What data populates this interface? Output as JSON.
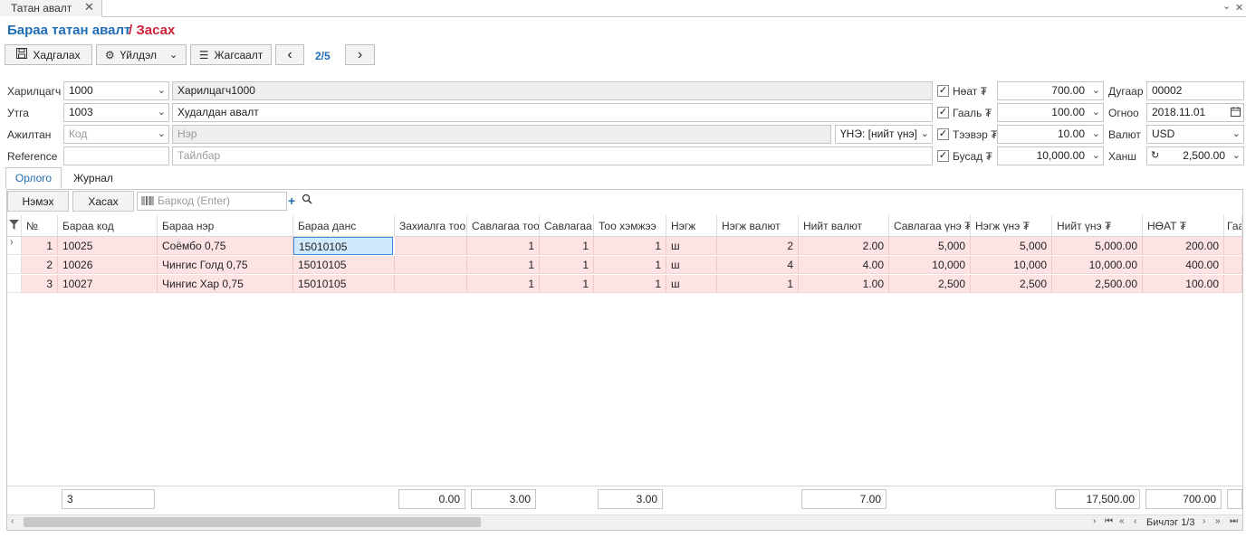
{
  "tab": {
    "label": "Татан авалт",
    "close": "✕"
  },
  "window": {
    "chevron": "⌄",
    "close": "✕"
  },
  "header": {
    "title": "Бараа татан авалт",
    "subtitle": "/ Засах"
  },
  "toolbar": {
    "save_label": "Хадгалах",
    "action_label": "Үйлдэл",
    "list_label": "Жагсаалт",
    "page": "2/5"
  },
  "form": {
    "partner": {
      "label": "Харилцагч",
      "code": "1000",
      "name": "Харилцагч1000"
    },
    "route": {
      "label": "Утга",
      "code": "1003",
      "name": "Худалдан авалт"
    },
    "employee": {
      "label": "Ажилтан",
      "code_placeholder": "Код",
      "name_placeholder": "Нэр",
      "price_mode": "ҮНЭ: [нийт үнэ]"
    },
    "reference": {
      "label": "Reference",
      "value": "",
      "desc_placeholder": "Тайлбар"
    },
    "vat": {
      "label": "Нөат ₮",
      "checked": true,
      "value": "700.00"
    },
    "customs": {
      "label": "Гааль ₮",
      "checked": true,
      "value": "100.00"
    },
    "transport": {
      "label": "Тээвэр ₮",
      "checked": true,
      "value": "10.00"
    },
    "other": {
      "label": "Бусад ₮",
      "checked": true,
      "value": "10,000.00"
    },
    "number": {
      "label": "Дугаар",
      "value": "00002"
    },
    "date": {
      "label": "Огноо",
      "value": "2018.11.01"
    },
    "currency": {
      "label": "Валют",
      "value": "USD"
    },
    "rate": {
      "label": "Ханш",
      "value": "2,500.00"
    }
  },
  "subtabs": {
    "income": "Орлого",
    "journal": "Журнал"
  },
  "grid_toolbar": {
    "add_label": "Нэмэх",
    "remove_label": "Хасах",
    "barcode_placeholder": "Баркод (Enter)"
  },
  "columns": [
    "№",
    "Бараа код",
    "Бараа нэр",
    "Бараа данс",
    "Захиалга тоо",
    "Савлагаа тоо",
    "Савлагаа",
    "Тоо хэмжээ",
    "Нэгж",
    "Нэгж валют",
    "Нийт валют",
    "Савлагаа үнэ ₮",
    "Нэгж үнэ ₮",
    "Нийт үнэ ₮",
    "НӨАТ ₮",
    "Гаа"
  ],
  "rows": [
    {
      "no": "1",
      "code": "10025",
      "name": "Соёмбо 0,75",
      "account": "15010105",
      "order_qty": "",
      "pack_qty": "1",
      "pack": "1",
      "qty": "1",
      "unit": "ш",
      "unit_cur": "2",
      "total_cur": "2.00",
      "pack_price": "5,000",
      "unit_price": "5,000",
      "total_price": "5,000.00",
      "vat": "200.00"
    },
    {
      "no": "2",
      "code": "10026",
      "name": "Чингис Голд 0,75",
      "account": "15010105",
      "order_qty": "",
      "pack_qty": "1",
      "pack": "1",
      "qty": "1",
      "unit": "ш",
      "unit_cur": "4",
      "total_cur": "4.00",
      "pack_price": "10,000",
      "unit_price": "10,000",
      "total_price": "10,000.00",
      "vat": "400.00"
    },
    {
      "no": "3",
      "code": "10027",
      "name": "Чингис Хар 0,75",
      "account": "15010105",
      "order_qty": "",
      "pack_qty": "1",
      "pack": "1",
      "qty": "1",
      "unit": "ш",
      "unit_cur": "1",
      "total_cur": "1.00",
      "pack_price": "2,500",
      "unit_price": "2,500",
      "total_price": "2,500.00",
      "vat": "100.00"
    }
  ],
  "footer": {
    "count": "3",
    "order_qty": "0.00",
    "pack_qty": "3.00",
    "qty": "3.00",
    "total_cur": "7.00",
    "total_price": "17,500.00",
    "vat": "700.00"
  },
  "pagination": {
    "label": "Бичлэг 1/3"
  },
  "colors": {
    "accent": "#1f6db5",
    "subtitle": "#d0213a",
    "row_bg": "#fde3e3",
    "selected": "#cfe8fb"
  }
}
